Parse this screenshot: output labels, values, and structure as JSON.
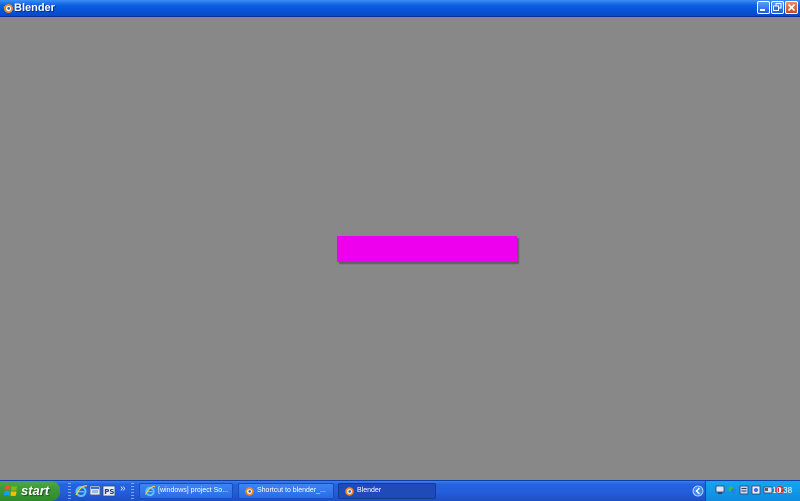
{
  "window": {
    "title": "Blender",
    "buttons": {
      "minimize": "minimize-icon",
      "maximize": "restore-icon",
      "close": "close-icon"
    }
  },
  "workspace": {
    "background": "#888888",
    "bar_color": "#ee00ee"
  },
  "taskbar": {
    "start_label": "start",
    "quick_launch": [
      "internet-explorer-icon",
      "windows-explorer-icon",
      "photoshop-icon"
    ],
    "quick_launch_more": "»",
    "tasks": [
      {
        "label": "[windows] project So...",
        "icon": "internet-explorer-icon",
        "active": false
      },
      {
        "label": "Shortcut to blender_...",
        "icon": "blender-icon",
        "active": false
      },
      {
        "label": "Blender",
        "icon": "blender-icon",
        "active": true
      }
    ],
    "tray_icons": [
      "network-icon",
      "msn-icon",
      "tray-app-icon",
      "tray-app-icon",
      "tray-app-icon",
      "antivirus-icon"
    ],
    "clock": "10:38"
  }
}
